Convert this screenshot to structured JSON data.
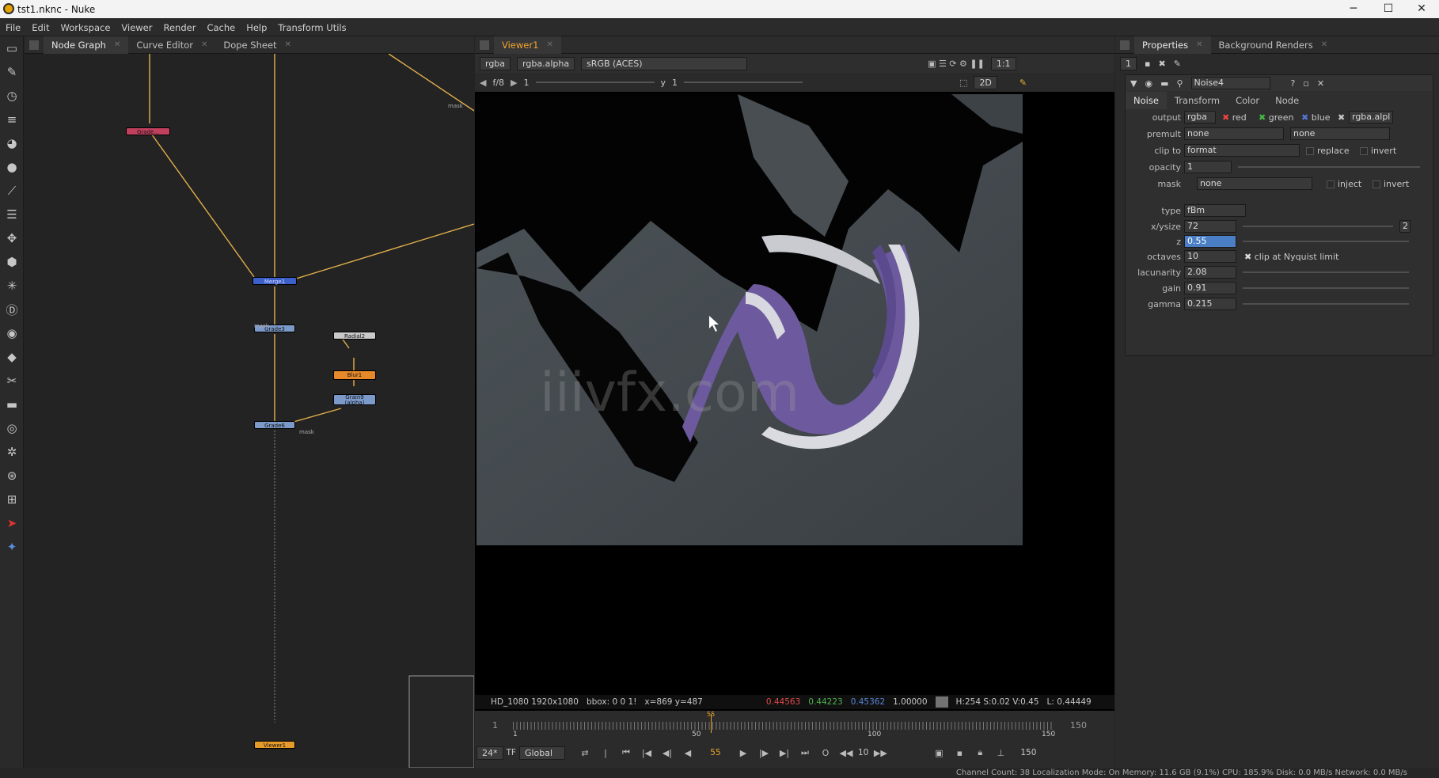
{
  "window": {
    "title": "tst1.nknc - Nuke",
    "minimize": "─",
    "maximize": "☐",
    "close": "✕"
  },
  "menu": [
    "File",
    "Edit",
    "Workspace",
    "Viewer",
    "Render",
    "Cache",
    "Help",
    "Transform Utils"
  ],
  "toolbar_icons": [
    "image-icon",
    "paint-icon",
    "time-icon",
    "channel-icon",
    "color-icon",
    "filter-icon",
    "keyer-icon",
    "merge-icon",
    "transform-icon",
    "3d-icon",
    "particles-icon",
    "deep-icon",
    "views-icon",
    "metadata-icon",
    "toolsets-icon",
    "other-icon",
    "furnace-icon",
    "ocula-icon",
    "cara-icon",
    "nukex-icon",
    "eye-icon",
    "stars-icon"
  ],
  "left_tabs": [
    {
      "label": "Node Graph"
    },
    {
      "label": "Curve Editor"
    },
    {
      "label": "Dope Sheet"
    }
  ],
  "nodes": {
    "n1": "Grade...",
    "n2": "Merge1",
    "n3": "Grade3",
    "n4": "Radial2",
    "n5": "Blur1",
    "n6": "Grain9",
    "n6b": "(alpha)",
    "n7": "Grade6",
    "n8": "Viewer1",
    "mask1": "mask",
    "mask2": "mask",
    "mask3": "mask"
  },
  "viewer": {
    "tab": "Viewer1",
    "channels": "rgba",
    "alpha": "rgba.alpha",
    "colorspace": "sRGB (ACES)",
    "zoom": "1:1",
    "fstop": "f/8",
    "frame_step": "1",
    "gain_label": "y",
    "gain_value": "1",
    "mode": "2D",
    "watermark": "iiivfx.com",
    "info_format": "HD_1080 1920x1080",
    "info_bbox": "bbox: 0 0 1!",
    "info_xy": "x=869 y=487",
    "pix_r": "0.44563",
    "pix_g": "0.44223",
    "pix_b": "0.45362",
    "pix_a": "1.00000",
    "hsv": "H:254 S:0.02 V:0.45",
    "lum": "L: 0.44449"
  },
  "timeline": {
    "start": "1",
    "end": "150",
    "current": "55",
    "in": "1",
    "out": "150",
    "ticks": [
      "1",
      "50",
      "100",
      "150"
    ],
    "fps": "24*",
    "tf": "TF",
    "scope": "Global",
    "play_increment": "10"
  },
  "properties": {
    "tabs": [
      {
        "label": "Properties"
      },
      {
        "label": "Background Renders"
      }
    ],
    "max_panels": "1",
    "node_name": "Noise4",
    "subtabs": [
      "Noise",
      "Transform",
      "Color",
      "Node"
    ],
    "output_label": "output",
    "output_value": "rgba",
    "ch_red": "red",
    "ch_green": "green",
    "ch_blue": "blue",
    "ch_alpha": "rgba.alpl",
    "premult_label": "premult",
    "premult_value": "none",
    "premult_value2": "none",
    "clip_label": "clip to",
    "clip_value": "format",
    "replace": "replace",
    "invert": "invert",
    "opacity_label": "opacity",
    "opacity_value": "1",
    "mask_label": "mask",
    "mask_value": "none",
    "inject": "inject",
    "invert2": "invert",
    "type_label": "type",
    "type_value": "fBm",
    "xysize_label": "x/ysize",
    "xysize_value": "72",
    "xysize_chan": "2",
    "z_label": "z",
    "z_value": "0.55",
    "octaves_label": "octaves",
    "octaves_value": "10",
    "nyquist": "clip at Nyquist limit",
    "lacunarity_label": "lacunarity",
    "lacunarity_value": "2.08",
    "gain_label": "gain",
    "gain_value": "0.91",
    "gamma_label": "gamma",
    "gamma_value": "0.215"
  },
  "status": "Channel Count: 38  Localization Mode: On  Memory: 11.6 GB (9.1%)  CPU: 185.9%  Disk: 0.0 MB/s  Network: 0.0 MB/s"
}
